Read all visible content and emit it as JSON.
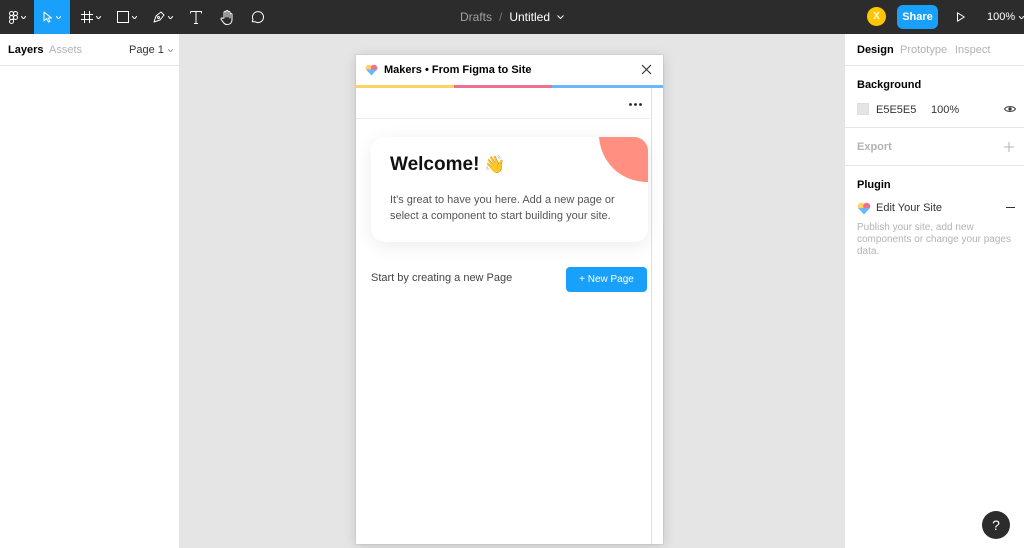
{
  "toolbar": {
    "tools": [
      "main-menu",
      "move",
      "frame",
      "shape",
      "pen",
      "text",
      "hand",
      "comment"
    ],
    "breadcrumb_folder": "Drafts",
    "breadcrumb_sep": "/",
    "file_name": "Untitled",
    "avatar_initial": "X",
    "share_label": "Share",
    "zoom_label": "100%"
  },
  "left_panel": {
    "tabs": [
      "Layers",
      "Assets"
    ],
    "active_tab": "Layers",
    "page_select": "Page 1"
  },
  "right_panel": {
    "tabs": [
      "Design",
      "Prototype",
      "Inspect"
    ],
    "active_tab": "Design",
    "background": {
      "title": "Background",
      "hex": "E5E5E5",
      "opacity": "100%",
      "swatch_color": "#E5E5E5"
    },
    "export": {
      "title": "Export"
    },
    "plugin": {
      "title": "Plugin",
      "name": "Edit Your Site",
      "description": "Publish your site, add new components or change your pages data."
    }
  },
  "plugin_window": {
    "title": "Makers • From Figma to Site",
    "stripe_colors": [
      "#ffd166",
      "#ef6f8f",
      "#6ab7ff"
    ],
    "welcome": {
      "title": "Welcome!",
      "emoji": "👋",
      "body": "It's great to have you here. Add a new page or select a component to start building your site."
    },
    "start_text": "Start by creating a new Page",
    "new_page_button": "+ New Page"
  },
  "help_label": "?",
  "colors": {
    "accent": "#18A0FB",
    "toolbar_bg": "#2C2C2C",
    "canvas_bg": "#E5E5E5",
    "avatar": "#FFC700",
    "blob": "#FF8F80"
  }
}
